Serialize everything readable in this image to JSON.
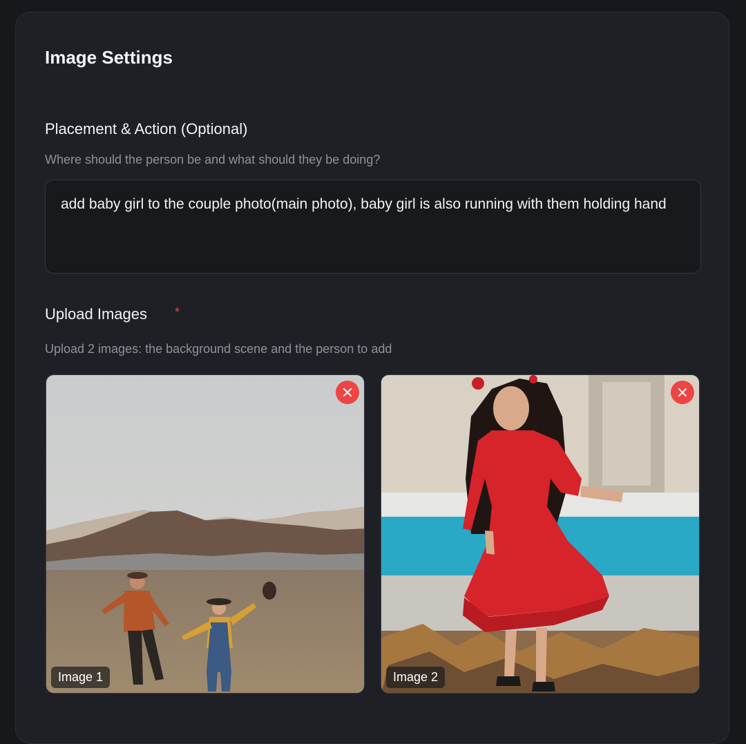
{
  "panel": {
    "title": "Image Settings"
  },
  "placement": {
    "label": "Placement & Action (Optional)",
    "help": "Where should the person be and what should they be doing?",
    "value": "add baby girl to the couple photo(main photo), baby girl is also running with them holding hand"
  },
  "upload": {
    "label": "Upload Images",
    "required_mark": "*",
    "help": "Upload 2 images: the background scene and the person to add",
    "images": [
      {
        "caption": "Image 1",
        "remove_icon": "close-icon"
      },
      {
        "caption": "Image 2",
        "remove_icon": "close-icon"
      }
    ]
  },
  "colors": {
    "background": "#17181c",
    "card": "#1f2025",
    "accent_danger": "#ef4444",
    "muted_text": "#8c929e"
  }
}
